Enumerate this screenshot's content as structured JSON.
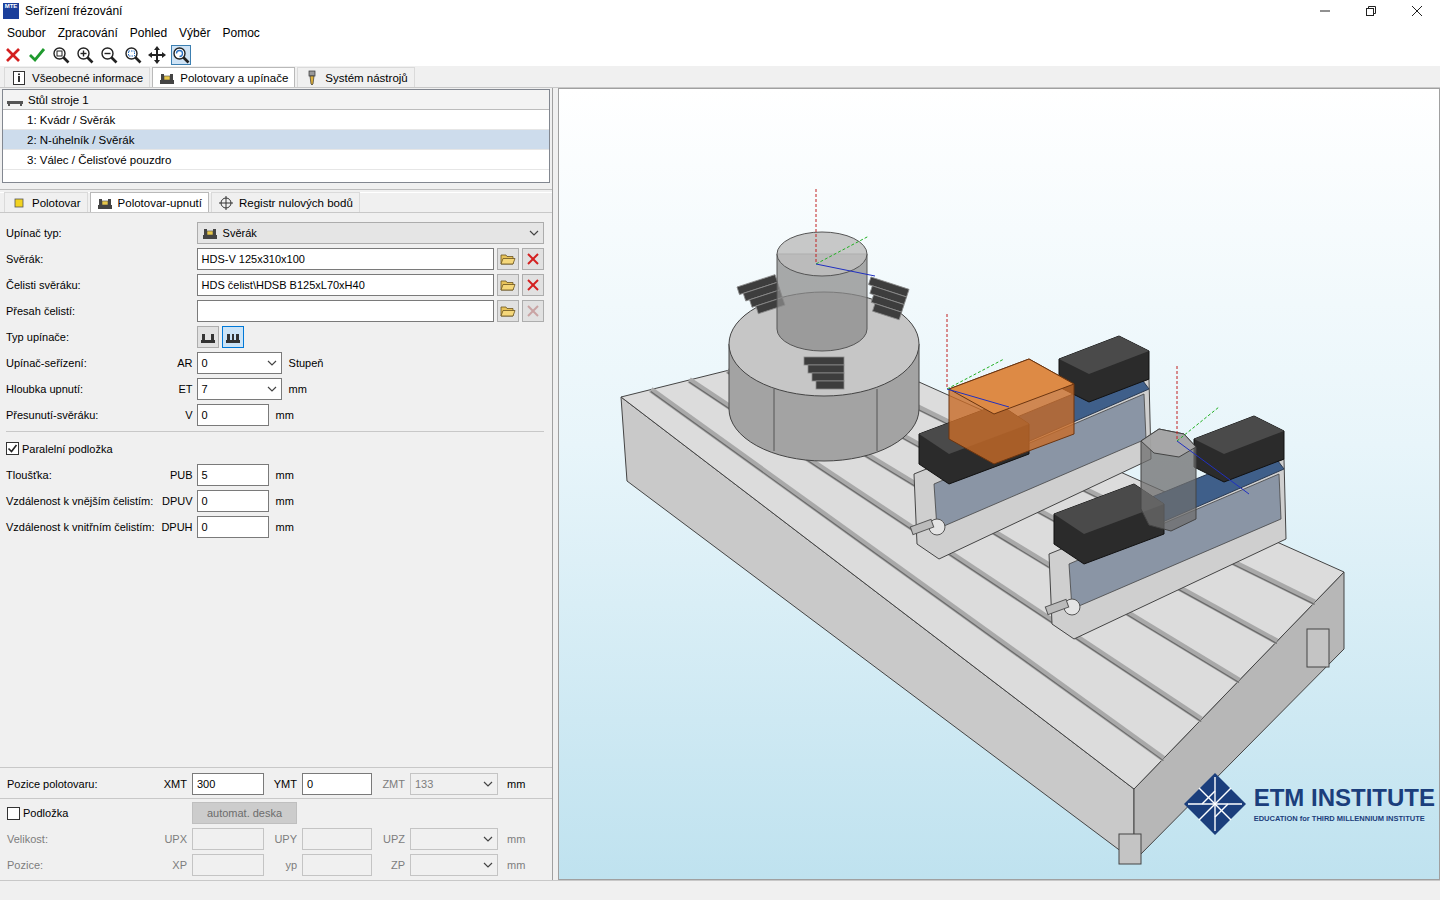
{
  "window": {
    "title": "Seřízení frézování",
    "app_icon_text": "MTE"
  },
  "menu": [
    "Soubor",
    "Zpracování",
    "Pohled",
    "Výběr",
    "Pomoc"
  ],
  "toolbar": [
    {
      "kind": "cancel",
      "selected": false
    },
    {
      "kind": "confirm",
      "selected": false
    },
    {
      "kind": "zoom-all",
      "selected": false
    },
    {
      "kind": "zoom-in",
      "selected": false
    },
    {
      "kind": "zoom-out",
      "selected": false
    },
    {
      "kind": "zoom-window",
      "selected": false
    },
    {
      "kind": "pan",
      "selected": false
    },
    {
      "kind": "rotate",
      "selected": true
    }
  ],
  "main_tabs": [
    {
      "label": "Všeobecné informace",
      "kind": "info",
      "selected": false
    },
    {
      "label": "Polotovary a upínače",
      "kind": "fixture",
      "selected": true
    },
    {
      "label": "Systém nástrojů",
      "kind": "tool",
      "selected": false
    }
  ],
  "tree": {
    "root": "Stůl stroje 1",
    "items": [
      {
        "label": "1: Kvádr / Svěrák",
        "selected": false
      },
      {
        "label": "2: N-úhelník / Svěrák",
        "selected": true
      },
      {
        "label": "3: Válec / Čelisťové pouzdro",
        "selected": false
      }
    ]
  },
  "sub_tabs": [
    {
      "label": "Polotovar",
      "kind": "blank",
      "selected": false
    },
    {
      "label": "Polotovar-upnutí",
      "kind": "fixture",
      "selected": true
    },
    {
      "label": "Registr nulových bodů",
      "kind": "zero",
      "selected": false
    }
  ],
  "form": [
    {
      "kind": "select",
      "label": "Upínač typ:",
      "value": "Svěrák"
    },
    {
      "kind": "file",
      "label": "Svěrák:",
      "value": "HDS-V 125x310x100",
      "clear_disabled": false
    },
    {
      "kind": "file",
      "label": "Čelisti svěráku:",
      "value": "HDS čelist\\HDSB B125xL70xH40",
      "clear_disabled": false
    },
    {
      "kind": "file",
      "label": "Přesah čelistí:",
      "value": "",
      "clear_disabled": true
    },
    {
      "kind": "toggle",
      "label": "Typ upínače:",
      "options": [
        {
          "kind": "single",
          "selected": false
        },
        {
          "kind": "double",
          "selected": true
        }
      ]
    },
    {
      "kind": "combo",
      "label": "Upínač-seřízení:",
      "code": "AR",
      "value": "0",
      "unit": "Stupeň"
    },
    {
      "kind": "combo",
      "label": "Hloubka upnutí:",
      "code": "ET",
      "value": "7",
      "unit": "mm"
    },
    {
      "kind": "input",
      "label": "Přesunutí-svěráku:",
      "code": "V",
      "value": "0",
      "unit": "mm"
    }
  ],
  "parallel_pad": {
    "label": "Paralelní podložka",
    "checked": true,
    "rows": [
      {
        "kind": "input",
        "label": "Tloušťka:",
        "code": "PUB",
        "value": "5",
        "unit": "mm"
      },
      {
        "kind": "input",
        "label": "Vzdálenost k vnějším čelistím:",
        "code": "DPUV",
        "value": "0",
        "unit": "mm"
      },
      {
        "kind": "input",
        "label": "Vzdálenost k vnitřním čelistím:",
        "code": "DPUH",
        "value": "0",
        "unit": "mm"
      }
    ]
  },
  "position": {
    "label": "Pozice polotovaru:",
    "unit": "mm",
    "disabled": false,
    "fields": [
      {
        "code": "XMT",
        "value": "300",
        "kind": "input",
        "disabled": false
      },
      {
        "code": "YMT",
        "value": "0",
        "kind": "input",
        "disabled": false
      },
      {
        "code": "ZMT",
        "value": "133",
        "kind": "combo",
        "disabled": true
      }
    ]
  },
  "pad": {
    "label": "Podložka",
    "checked": false,
    "button": {
      "label": "automat. deska",
      "disabled": true
    },
    "rows": [
      {
        "label": "Velikost:",
        "unit": "mm",
        "disabled": true,
        "fields": [
          {
            "code": "UPX",
            "value": "",
            "kind": "input",
            "disabled": true
          },
          {
            "code": "UPY",
            "value": "",
            "kind": "input",
            "disabled": true
          },
          {
            "code": "UPZ",
            "value": "",
            "kind": "combo",
            "disabled": true
          }
        ]
      },
      {
        "label": "Pozice:",
        "unit": "mm",
        "disabled": true,
        "fields": [
          {
            "code": "XP",
            "value": "",
            "kind": "input",
            "disabled": true
          },
          {
            "code": "yp",
            "value": "",
            "kind": "input",
            "disabled": true
          },
          {
            "code": "ZP",
            "value": "",
            "kind": "combo",
            "disabled": true
          }
        ]
      }
    ]
  },
  "viewport": {
    "logo": {
      "title": "ETM INSTITUTE",
      "subtitle": "EDUCATION for THIRD MILLENNIUM INSTITUTE"
    }
  }
}
